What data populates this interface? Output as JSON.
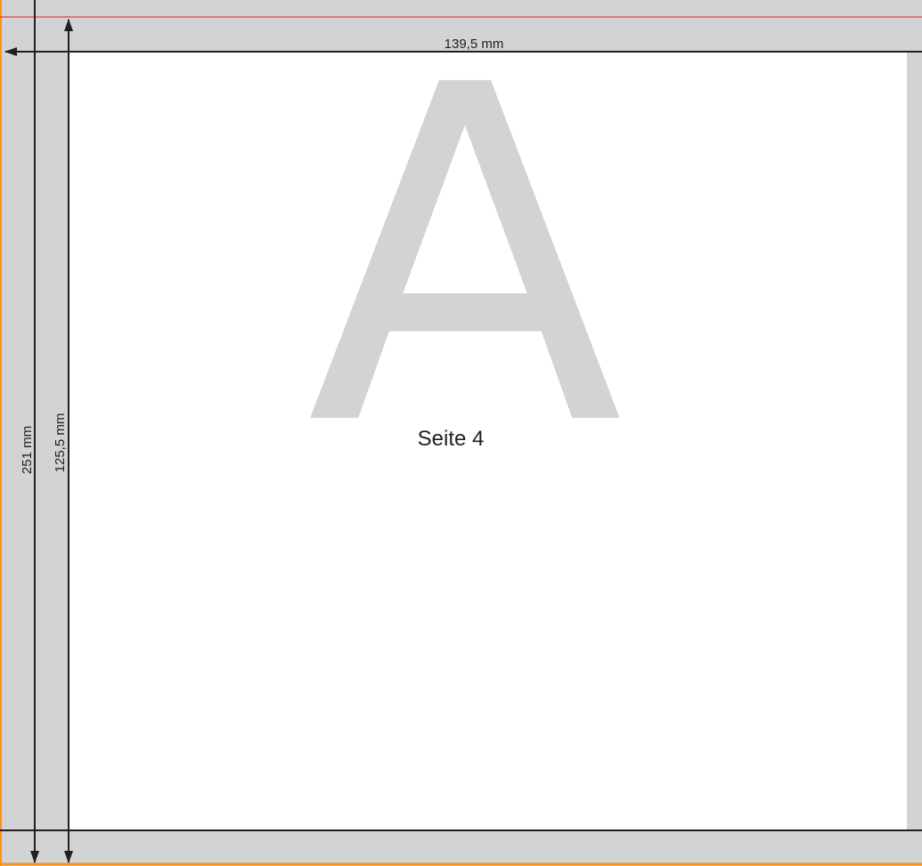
{
  "page_letter": "A",
  "page_label": "Seite 4",
  "dimensions": {
    "width": "139,5 mm",
    "full_height": "251 mm",
    "half_height": "125,5 mm"
  },
  "colors": {
    "background": "#d1d3d4",
    "page": "#ffffff",
    "letter": "#d1d3d4",
    "lines": "#231f20",
    "bleed_edge": "#f7941d",
    "trim_line": "#ed1c24"
  }
}
